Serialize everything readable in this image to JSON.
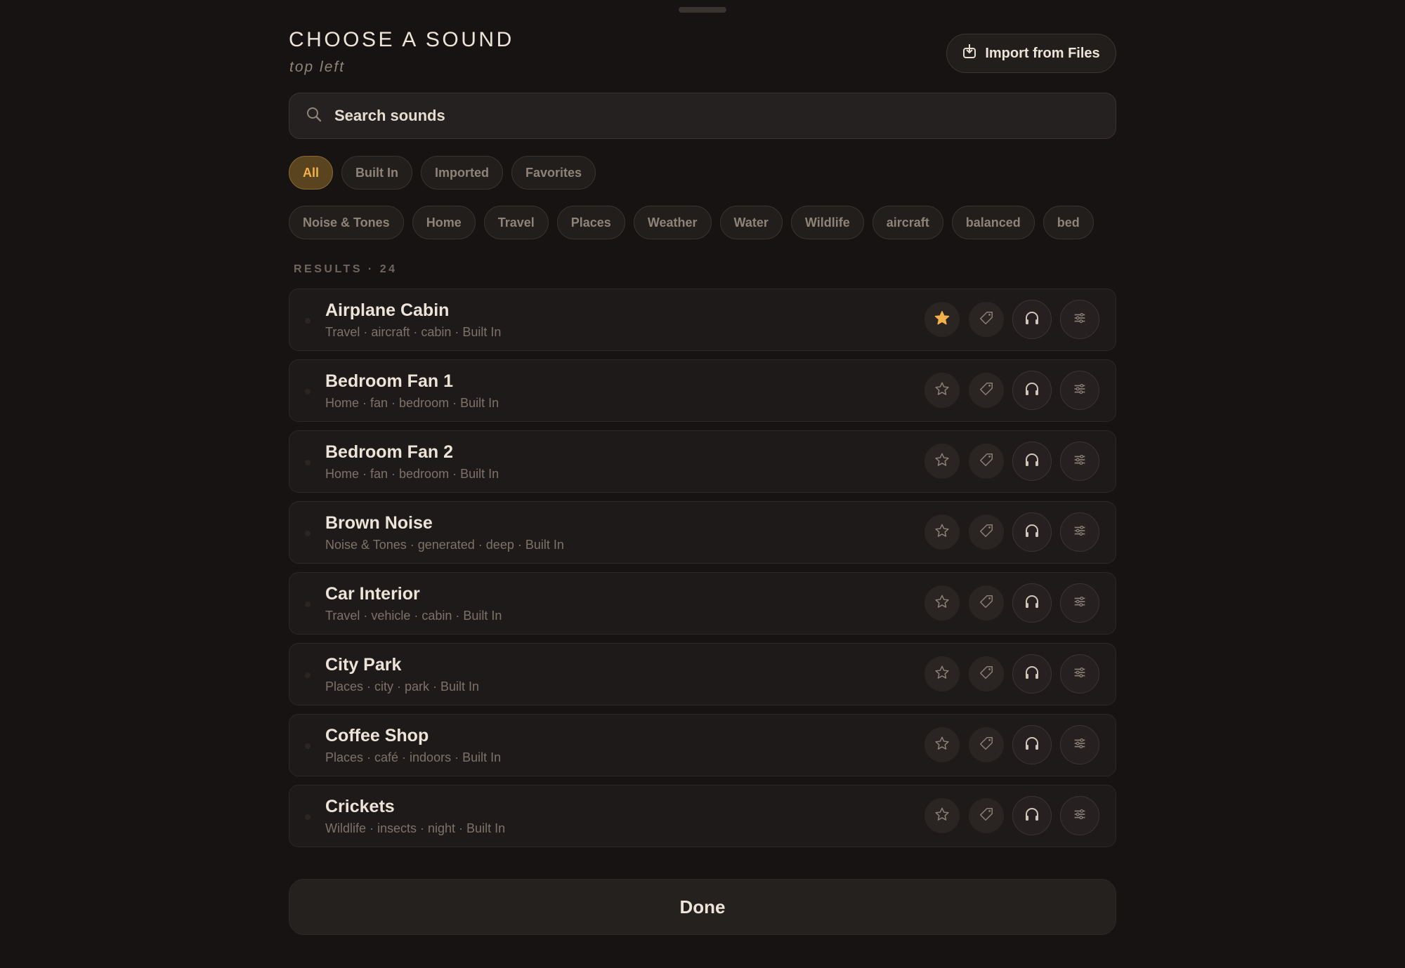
{
  "header": {
    "title": "CHOOSE A SOUND",
    "subtitle": "top left",
    "import_label": "Import from Files"
  },
  "search": {
    "placeholder": "Search sounds"
  },
  "filters": [
    "All",
    "Built In",
    "Imported",
    "Favorites"
  ],
  "active_filter": "All",
  "categories": [
    "Noise & Tones",
    "Home",
    "Travel",
    "Places",
    "Weather",
    "Water",
    "Wildlife",
    "aircraft",
    "balanced",
    "bed"
  ],
  "results_label": "RESULTS · 24",
  "sounds": [
    {
      "name": "Airplane Cabin",
      "meta": "Travel · aircraft · cabin · Built In",
      "favorite": true
    },
    {
      "name": "Bedroom Fan 1",
      "meta": "Home · fan · bedroom · Built In",
      "favorite": false
    },
    {
      "name": "Bedroom Fan 2",
      "meta": "Home · fan · bedroom · Built In",
      "favorite": false
    },
    {
      "name": "Brown Noise",
      "meta": "Noise & Tones · generated · deep · Built In",
      "favorite": false
    },
    {
      "name": "Car Interior",
      "meta": "Travel · vehicle · cabin · Built In",
      "favorite": false
    },
    {
      "name": "City Park",
      "meta": "Places · city · park · Built In",
      "favorite": false
    },
    {
      "name": "Coffee Shop",
      "meta": "Places · café · indoors · Built In",
      "favorite": false
    },
    {
      "name": "Crickets",
      "meta": "Wildlife · insects · night · Built In",
      "favorite": false
    }
  ],
  "row_icons": [
    "star-icon",
    "tag-icon",
    "headphones-icon",
    "sliders-icon"
  ],
  "done_label": "Done",
  "colors": {
    "background": "#161312",
    "accent": "#f2b24a",
    "card": "#1e1a19",
    "text": "#ece4d8",
    "muted": "#7c7269"
  }
}
